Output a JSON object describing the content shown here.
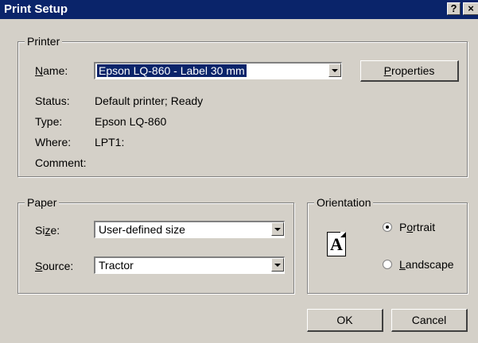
{
  "window": {
    "title": "Print Setup",
    "help_label": "?",
    "close_label": "×"
  },
  "printer": {
    "group_label": "Printer",
    "name_label": "Name:",
    "name_value": "Epson LQ-860 - Label 30 mm",
    "properties_button": "Properties",
    "status_label": "Status:",
    "status_value": "Default printer; Ready",
    "type_label": "Type:",
    "type_value": "Epson LQ-860",
    "where_label": "Where:",
    "where_value": "LPT1:",
    "comment_label": "Comment:",
    "comment_value": ""
  },
  "paper": {
    "group_label": "Paper",
    "size_label": "Size:",
    "size_value": "User-defined size",
    "source_label": "Source:",
    "source_value": "Tractor"
  },
  "orientation": {
    "group_label": "Orientation",
    "icon_letter": "A",
    "portrait_label": "Portrait",
    "landscape_label": "Landscape",
    "selected": "Portrait"
  },
  "buttons": {
    "ok": "OK",
    "cancel": "Cancel"
  }
}
